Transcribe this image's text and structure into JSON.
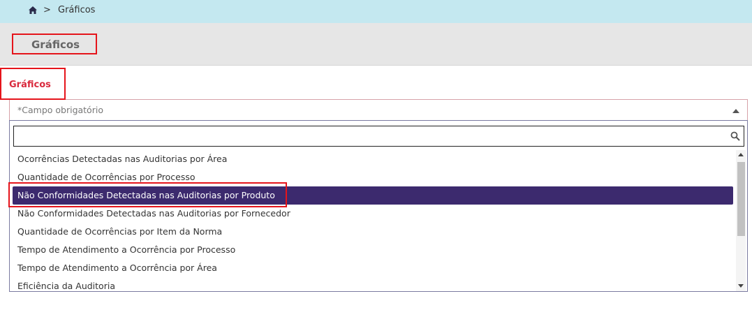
{
  "breadcrumb": {
    "home_icon": "home-icon",
    "separator": ">",
    "current": "Gráficos"
  },
  "header": {
    "title": "Gráficos"
  },
  "form": {
    "field_label": "Gráficos",
    "select_placeholder": "*Campo obrigatório",
    "search_value": "",
    "options": [
      "Ocorrências Detectadas nas Auditorias por Área",
      "Quantidade de Ocorrências por Processo",
      "Não Conformidades Detectadas nas Auditorias por Produto",
      "Não Conformidades Detectadas nas Auditorias por Fornecedor",
      "Quantidade de Ocorrências por Item da Norma",
      "Tempo de Atendimento a Ocorrência por Processo",
      "Tempo de Atendimento a Ocorrência por Área",
      "Eficiência da Auditoria"
    ],
    "highlighted_option": "Não Conformidades Detectadas nas Auditorias por Produto"
  },
  "colors": {
    "breadcrumb_bg": "#c4e8f0",
    "title_bar_bg": "#e6e6e6",
    "label_red": "#d92a3d",
    "highlight_bg": "#3c2a6e",
    "annotation_red": "#e5141b"
  }
}
